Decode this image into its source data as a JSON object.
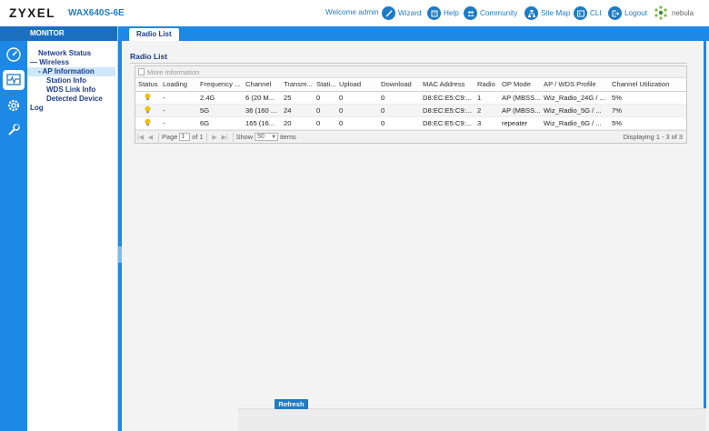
{
  "header": {
    "brand": "ZYXEL",
    "model": "WAX640S-6E",
    "welcome": "Welcome admin",
    "links": [
      {
        "label": "Wizard",
        "icon": "wand-icon"
      },
      {
        "label": "Help",
        "icon": "help-icon"
      },
      {
        "label": "Community",
        "icon": "community-icon"
      },
      {
        "label": "Site Map",
        "icon": "sitemap-icon"
      },
      {
        "label": "CLI",
        "icon": "cli-icon"
      },
      {
        "label": "Logout",
        "icon": "logout-icon"
      }
    ],
    "nebula": "nebula"
  },
  "colors": {
    "accent": "#1e88e5",
    "accent_dark": "#1b6fbf",
    "tree_text": "#1f3d8a",
    "bulb": "#f2c200"
  },
  "rail": {
    "buttons": [
      "dashboard-icon",
      "monitor-icon",
      "configuration-icon",
      "maintenance-icon"
    ]
  },
  "monitor": {
    "title": "MONITOR",
    "tree": [
      {
        "label": "Network Status"
      },
      {
        "label": "Wireless",
        "expander": "—"
      },
      {
        "label": "AP Information",
        "expander": "-"
      },
      {
        "label": "Station Info"
      },
      {
        "label": "WDS Link Info"
      },
      {
        "label": "Detected Device"
      },
      {
        "label": "Log"
      }
    ]
  },
  "main": {
    "tab": "Radio List",
    "section_title": "Radio List",
    "toolbar": {
      "more_info": "More Information"
    },
    "columns": [
      "Status",
      "Loading",
      "Frequency ...",
      "Channel",
      "Transm...",
      "Stati...",
      "Upload",
      "Download",
      "MAC Address",
      "Radio",
      "OP Mode",
      "AP / WDS Profile",
      "Channel Utilization"
    ],
    "rows": [
      {
        "loading": "-",
        "frequency": "2.4G",
        "channel": "6 (20 M...",
        "transmit": "25",
        "stations": "0",
        "upload": "0",
        "download": "0",
        "mac": "D8:EC:E5:C9:...",
        "radio": "1",
        "op_mode": "AP (MBSS...",
        "profile": "Wiz_Radio_24G / ...",
        "utilization": "5%"
      },
      {
        "loading": "-",
        "frequency": "5G",
        "channel": "36 (160 ...",
        "transmit": "24",
        "stations": "0",
        "upload": "0",
        "download": "0",
        "mac": "D8:EC:E5:C9:...",
        "radio": "2",
        "op_mode": "AP (MBSS...",
        "profile": "Wiz_Radio_5G / ...",
        "utilization": "7%"
      },
      {
        "loading": "-",
        "frequency": "6G",
        "channel": "165 (16...",
        "transmit": "20",
        "stations": "0",
        "upload": "0",
        "download": "0",
        "mac": "D8:EC:E5:C9:...",
        "radio": "3",
        "op_mode": "repeater",
        "profile": "Wiz_Radio_6G / ...",
        "utilization": "5%"
      }
    ],
    "pager": {
      "page_label": "Page",
      "page_value": "1",
      "of_label": "of 1",
      "show_label": "Show",
      "show_value": "50",
      "items_label": "items",
      "display": "Displaying 1 - 3 of 3"
    },
    "refresh": "Refresh"
  }
}
